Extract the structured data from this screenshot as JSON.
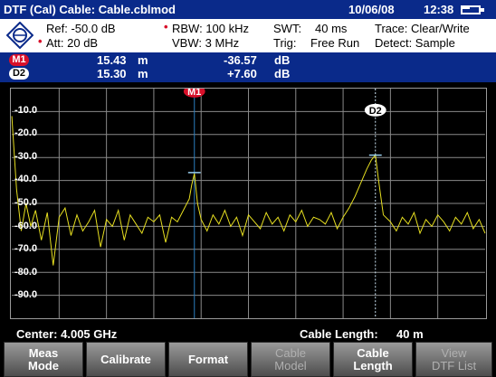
{
  "title_bar": {
    "title": "DTF (Cal)  Cable: Cable.cblmod",
    "date": "10/06/08",
    "time": "12:38",
    "battery_icon": "battery-icon"
  },
  "settings": {
    "ref": "Ref: -50.0 dB",
    "att": "Att: 20 dB",
    "rbw": "RBW:  100 kHz",
    "vbw": "VBW:  3 MHz",
    "swt_label": "SWT:",
    "swt_value": "40 ms",
    "trig_label": "Trig:",
    "trig_value": "Free Run",
    "trace": "Trace:  Clear/Write",
    "detect": "Detect: Sample",
    "logo_icon": "rohde-schwarz-logo"
  },
  "markers": [
    {
      "id": "M1",
      "distance": "15.43",
      "distance_unit": "m",
      "level": "-36.57",
      "level_unit": "dB"
    },
    {
      "id": "D2",
      "distance": "15.30",
      "distance_unit": "m",
      "level": "+7.60",
      "level_unit": "dB"
    }
  ],
  "plot_markers": {
    "m1_label": "M1",
    "d2_label": "D2"
  },
  "y_axis_labels": [
    "-10.0",
    "-20.0",
    "-30.0",
    "-40.0",
    "-50.0",
    "-60.0",
    "-70.0",
    "-80.0",
    "-90.0"
  ],
  "info": {
    "center": "Center: 4.005 GHz",
    "cable_length_label": "Cable Length:",
    "cable_length_value": "40 m"
  },
  "softkeys": [
    {
      "label": "Meas\nMode",
      "enabled": true
    },
    {
      "label": "Calibrate",
      "enabled": true
    },
    {
      "label": "Format",
      "enabled": true
    },
    {
      "label": "Cable\nModel",
      "enabled": false
    },
    {
      "label": "Cable\nLength",
      "enabled": true
    },
    {
      "label": "View\nDTF List",
      "enabled": false
    }
  ],
  "chart_data": {
    "type": "line",
    "xlabel": "",
    "ylabel": "",
    "ylim": [
      -100,
      0
    ],
    "y_ticks": [
      -10,
      -20,
      -30,
      -40,
      -50,
      -60,
      -70,
      -80,
      -90
    ],
    "xlim": [
      0,
      40
    ],
    "x_unit": "m",
    "grid": true,
    "colors": {
      "trace": "#e8e020",
      "grid": "#8a8a8a",
      "marker_m1": "#2a7fc0",
      "marker_d2": "#cfe7f7"
    },
    "markers": [
      {
        "name": "M1",
        "x": 15.43,
        "y": -36.57
      },
      {
        "name": "D2",
        "x": 30.73,
        "y": -28.97
      }
    ],
    "series": [
      {
        "x": [
          0,
          0.4,
          0.8,
          1.2,
          1.6,
          2.0,
          2.5,
          3.0,
          3.5,
          4.0,
          4.5,
          5.0,
          5.5,
          6.0,
          6.5,
          7.0,
          7.5,
          8.0,
          8.5,
          9.0,
          9.5,
          10.0,
          10.5,
          11.0,
          11.5,
          12.0,
          12.5,
          13.0,
          13.5,
          14.0,
          14.5,
          15.0,
          15.2,
          15.43,
          15.7,
          16.0,
          16.5,
          17.0,
          17.5,
          18.0,
          18.5,
          19.0,
          19.5,
          20.0,
          20.5,
          21.0,
          21.5,
          22.0,
          22.5,
          23.0,
          23.5,
          24.0,
          24.5,
          25.0,
          25.5,
          26.0,
          26.5,
          27.0,
          27.5,
          28.0,
          28.5,
          29.0,
          29.5,
          30.0,
          30.4,
          30.73,
          31.0,
          31.4,
          32.0,
          32.5,
          33.0,
          33.5,
          34.0,
          34.5,
          35.0,
          35.5,
          36.0,
          36.5,
          37.0,
          37.5,
          38.0,
          38.5,
          39.0,
          39.5,
          40.0
        ],
        "values": [
          -12,
          -44,
          -62,
          -50,
          -60,
          -53,
          -66,
          -54,
          -77,
          -56,
          -52,
          -64,
          -55,
          -62,
          -58,
          -53,
          -69,
          -57,
          -60,
          -53,
          -66,
          -55,
          -59,
          -63,
          -56,
          -58,
          -55,
          -67,
          -56,
          -58,
          -53,
          -48,
          -42,
          -37,
          -50,
          -57,
          -62,
          -55,
          -59,
          -53,
          -60,
          -56,
          -64,
          -55,
          -58,
          -61,
          -54,
          -59,
          -56,
          -62,
          -55,
          -58,
          -53,
          -60,
          -56,
          -57,
          -59,
          -54,
          -61,
          -56,
          -52,
          -47,
          -41,
          -35,
          -31,
          -29,
          -40,
          -55,
          -58,
          -62,
          -56,
          -59,
          -54,
          -63,
          -57,
          -60,
          -55,
          -58,
          -62,
          -56,
          -59,
          -54,
          -61,
          -57,
          -63
        ]
      }
    ]
  }
}
